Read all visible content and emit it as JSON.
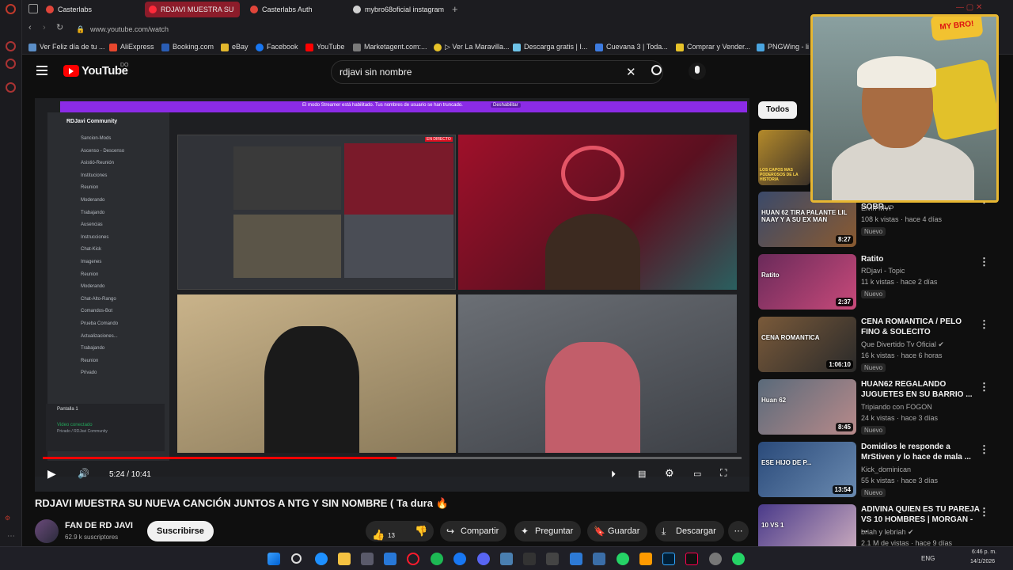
{
  "browser": {
    "tabs": [
      {
        "label": "Casterlabs",
        "color": "#e0453a",
        "active": false
      },
      {
        "label": "RDJAVI MUESTRA SU",
        "color": "#ff2a3a",
        "active": true
      },
      {
        "label": "Casterlabs Auth",
        "color": "#e0453a",
        "active": false
      },
      {
        "label": "mybro68oficial instagram",
        "color": "#d0d0d0",
        "active": false
      }
    ],
    "url": "www.youtube.com/watch",
    "bookmarks": [
      {
        "label": "Ver Feliz día de tu ...",
        "color": "#5b8ec7"
      },
      {
        "label": "AliExpress",
        "color": "#e7472e"
      },
      {
        "label": "Booking.com",
        "color": "#2a5db5"
      },
      {
        "label": "eBay",
        "color": "#e2b72d"
      },
      {
        "label": "Facebook",
        "color": "#1877f2"
      },
      {
        "label": "YouTube",
        "color": "#ff0000"
      },
      {
        "label": "Marketagent.com:...",
        "color": "#7a7a7a"
      },
      {
        "label": "▷ Ver La Maravilla...",
        "color": "#e6c229"
      },
      {
        "label": "Descarga gratis | I...",
        "color": "#6ec3e8"
      },
      {
        "label": "Cuevana 3 | Toda...",
        "color": "#3d7be0"
      },
      {
        "label": "Comprar y Vender...",
        "color": "#e6c229"
      },
      {
        "label": "PNGWing - li",
        "color": "#4aa5e0"
      }
    ]
  },
  "youtube": {
    "logo_text": "YouTube",
    "logo_country": "DO",
    "search_query": "rdjavi sin nombre",
    "filter_chip": "Todos"
  },
  "player": {
    "banner_text": "El modo Streamer está habilitado. Tus nombres de usuario se han truncado.",
    "banner_button": "Deshabilitar",
    "discord_server": "RDJavi Community",
    "time": "5:24 / 10:41",
    "progress": 0.506,
    "discord_channels": [
      "Sancion-Mods",
      "Ascenso - Descenso",
      "Asistió-Reunión",
      "Instituciones",
      "Reunion",
      "Moderando",
      "Trabajando",
      "Ausencias",
      "Instrucciones",
      "Chat-Kick",
      "Imagenes",
      "Reunion",
      "Moderando",
      "Chat-Alto-Rango",
      "Comandos-Bot",
      "Prueba Comando",
      "Actualizaciones...",
      "Trabajando",
      "Reunion",
      "Privado"
    ],
    "voice_status": "Video conectado",
    "voice_sub": "Privado / RDJavi Community",
    "screen_label": "Pantalla 1",
    "live_badge": "EN DIRECTO"
  },
  "video": {
    "title": "RDJAVI MUESTRA SU NUEVA CANCIÓN JUNTOS A NTG Y SIN NOMBRE ( Ta dura 🔥",
    "channel": "FAN DE RD JAVI",
    "subscribers": "62.9 k suscriptores",
    "subscribe_label": "Suscribirse",
    "likes": "13",
    "share_label": "Compartir",
    "ask_label": "Preguntar",
    "save_label": "Guardar",
    "download_label": "Descargar"
  },
  "recommendations": [
    {
      "title": "NAAY Y HABLA CLARO SOBR...",
      "channel": "Elvin MVP",
      "meta": "108 k vistas · hace 4 días",
      "badge": "Nuevo",
      "duration": "8:27",
      "thumb_text": "HUAN 62 TIRA PALANTE LIL NAAY Y A SU EX MAN",
      "verified": false
    },
    {
      "title": "Ratito",
      "channel": "RDjavi - Topic",
      "meta": "11 k vistas · hace 2 días",
      "badge": "Nuevo",
      "duration": "2:37",
      "thumb_text": "Ratito",
      "verified": false
    },
    {
      "title": "CENA ROMANTICA / PELO FINO & SOLECITO",
      "channel": "Que Divertido Tv Oficial",
      "meta": "16 k vistas · hace 6 horas",
      "badge": "Nuevo",
      "duration": "1:06:10",
      "thumb_text": "CENA ROMANTICA",
      "verified": true
    },
    {
      "title": "HUAN62 REGALANDO JUGUETES EN SU BARRIO ...",
      "channel": "Tripiando con FOGON",
      "meta": "24 k vistas · hace 3 días",
      "badge": "Nuevo",
      "duration": "8:45",
      "thumb_text": "Huan 62",
      "verified": false
    },
    {
      "title": "Domidios le responde a MrStiven y lo hace de mala ...",
      "channel": "Kick_dominican",
      "meta": "55 k vistas · hace 3 días",
      "badge": "Nuevo",
      "duration": "13:54",
      "thumb_text": "ESE HIJO DE P...",
      "verified": false
    },
    {
      "title": "ADIVINA QUIEN ES TU PAREJA VS 10 HOMBRES | MORGAN - ...",
      "channel": "briah y lebriah",
      "meta": "2.1 M de vistas · hace 9 días",
      "badge": "",
      "duration": "",
      "thumb_text": "10 VS 1",
      "verified": true
    }
  ],
  "top_thumb_text": "LOS CAPOS MAS PODEROSOS DE LA HISTORIA",
  "webcam_badge": "MY BRO!",
  "taskbar": {
    "lang": "ENG",
    "time": "6:46 p. m.",
    "date": "14/1/2026"
  }
}
